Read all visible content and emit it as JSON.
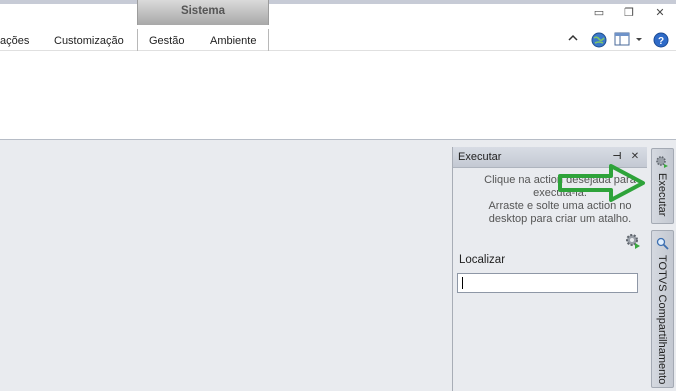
{
  "titlebar": {
    "context_tab": "Sistema",
    "minimize_glyph": "▭",
    "restore_glyph": "❐",
    "close_glyph": "✕"
  },
  "menu": {
    "items": [
      "ações",
      "Customização",
      "Gestão",
      "Ambiente"
    ]
  },
  "toolbar_icons": [
    "collapse-ribbon-icon",
    "globe-icon",
    "layout-icon",
    "help-icon"
  ],
  "panel": {
    "title": "Executar",
    "pin_glyph": "⊣",
    "close_glyph": "✕",
    "hint_click": "Clique na action desejada para executá-la.",
    "hint_drag": "Arraste e solte uma action no desktop para criar um atalho.",
    "search_label": "Localizar",
    "search_value": ""
  },
  "side_tabs": [
    {
      "label": "Executar",
      "icon": "gear-icon"
    },
    {
      "label": "TOTVS Compartilhamento",
      "icon": "magnifier-icon"
    }
  ],
  "colors": {
    "annotation_arrow": "#2ea33a",
    "background": "#e9ebef"
  }
}
